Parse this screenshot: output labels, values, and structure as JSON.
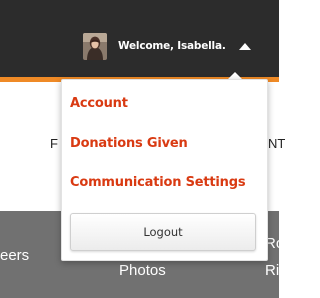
{
  "header": {
    "user_menu": {
      "welcome_text": "Welcome, Isabella.",
      "avatar_icon": "user-avatar-photo",
      "caret_icon": "caret-up-icon"
    },
    "accent_color": "#ef8a26",
    "bar_color": "#2c2c2c"
  },
  "dropdown": {
    "items": [
      {
        "label": "Account"
      },
      {
        "label": "Donations Given"
      },
      {
        "label": "Communication Settings"
      }
    ],
    "item_color": "#d93a12",
    "logout_label": "Logout"
  },
  "background": {
    "nav_fragment_left": "F",
    "nav_fragment_right": "NT",
    "band_left": "eers",
    "band_middle": "Photos",
    "band_right_top": "Ro",
    "band_right_bottom": "Ri",
    "band_color": "#717171"
  }
}
